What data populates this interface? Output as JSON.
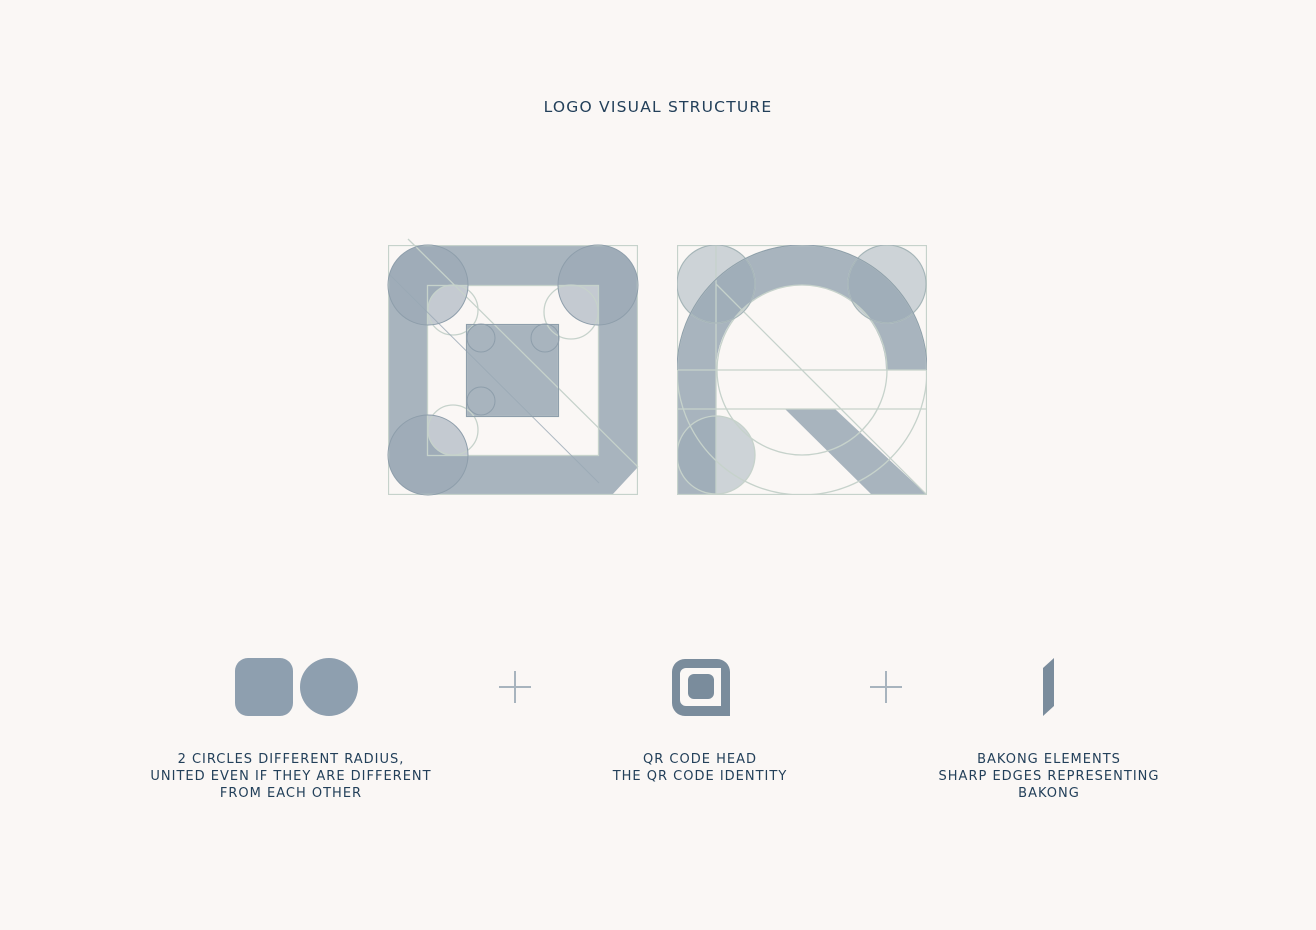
{
  "title": "LOGO VISUAL STRUCTURE",
  "colors": {
    "background": "#faf7f5",
    "fill_light": "#a8b4be",
    "fill_dark": "#8698a8",
    "element_dark": "#7a8c9c",
    "guide_lines": "#c6d2cb",
    "text": "#23405a",
    "plus": "#a8b4be"
  },
  "elements": [
    {
      "name": "two-circles",
      "lines": [
        "2 CIRCLES DIFFERENT RADIUS,",
        "UNITED EVEN IF THEY ARE DIFFERENT",
        "FROM EACH OTHER"
      ]
    },
    {
      "name": "qr-code-head",
      "lines": [
        "QR CODE HEAD",
        "THE QR CODE IDENTITY"
      ]
    },
    {
      "name": "bakong-elements",
      "lines": [
        "BAKONG ELEMENTS",
        "SHARP EDGES REPRESENTING",
        "BAKONG"
      ]
    }
  ],
  "icons": [
    "plus-icon",
    "plus-icon"
  ]
}
